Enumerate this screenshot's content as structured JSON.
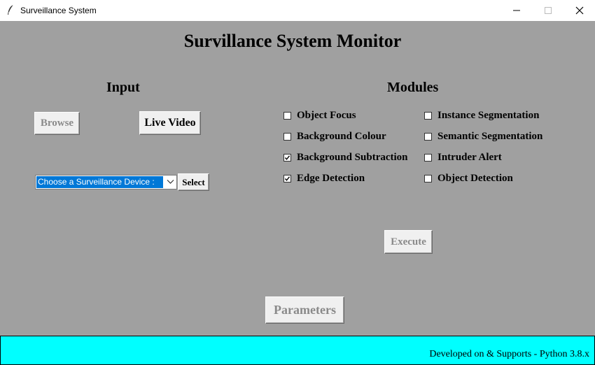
{
  "window": {
    "title": "Surveillance System",
    "icon": "feather-icon",
    "controls": [
      "minimize-icon",
      "maximize-icon",
      "close-icon"
    ]
  },
  "main": {
    "title": "Survillance System Monitor",
    "input": {
      "heading": "Input",
      "browse_label": "Browse",
      "live_video_label": "Live Video",
      "device_select": {
        "value": "Choose a Surveillance Device :"
      },
      "select_label": "Select"
    },
    "modules": {
      "heading": "Modules",
      "items": [
        {
          "label": "Object Focus",
          "checked": false
        },
        {
          "label": "Instance Segmentation",
          "checked": false
        },
        {
          "label": "Background Colour",
          "checked": false
        },
        {
          "label": "Semantic Segmentation",
          "checked": false
        },
        {
          "label": "Background Subtraction",
          "checked": true
        },
        {
          "label": "Intruder Alert",
          "checked": false
        },
        {
          "label": "Edge Detection",
          "checked": true
        },
        {
          "label": "Object Detection",
          "checked": false
        }
      ],
      "execute_label": "Execute"
    },
    "parameters_label": "Parameters"
  },
  "footer": {
    "text": "Developed on & Supports - Python 3.8.x"
  },
  "colors": {
    "background": "#a0a0a0",
    "footer": "#00ffff",
    "selection": "#0078d7"
  }
}
